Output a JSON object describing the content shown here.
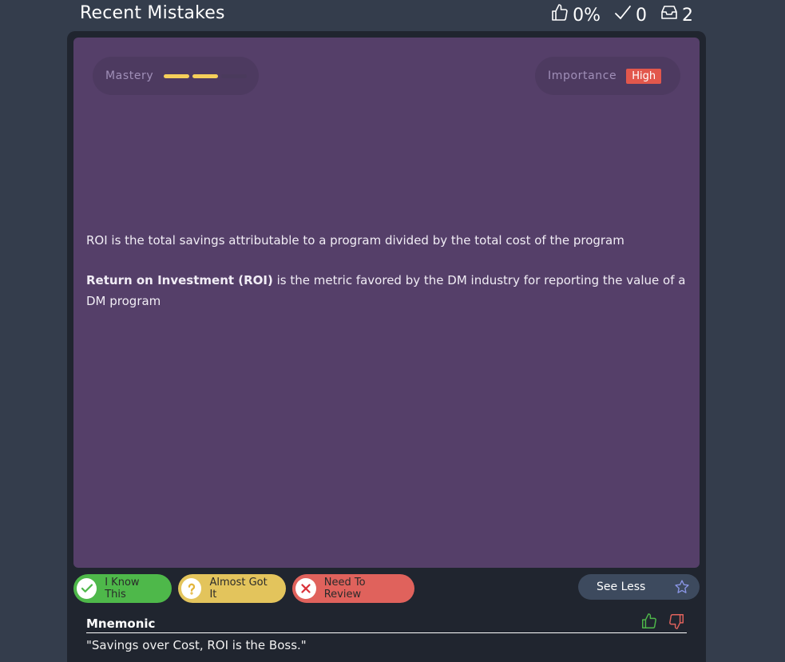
{
  "header": {
    "title": "Recent Mistakes",
    "stats": {
      "score": "0%",
      "correct": "0",
      "inbox": "2"
    }
  },
  "card": {
    "mastery_label": "Mastery",
    "mastery_level": 0.67,
    "importance_label": "Importance",
    "importance_value": "High",
    "statement": "ROI is the total savings attributable to a program divided by the total cost of the program",
    "definition_term": "Return on Investment (ROI)",
    "definition_rest": " is the metric favored by the DM industry for reporting the value of a DM program"
  },
  "actions": {
    "know": "I Know This",
    "almost": "Almost Got It",
    "review": "Need To Review",
    "see_less": "See Less"
  },
  "mnemonic": {
    "title": "Mnemonic",
    "text": "\"Savings over Cost, ROI is the Boss.\""
  },
  "colors": {
    "background": "#343d4c",
    "panel": "#20252f",
    "card": "#553f69",
    "mastery_fill": "#f5cf5a",
    "importance_badge": "#e2574c",
    "know": "#4eb84a",
    "almost": "#e3c45c",
    "review": "#e0625c"
  }
}
